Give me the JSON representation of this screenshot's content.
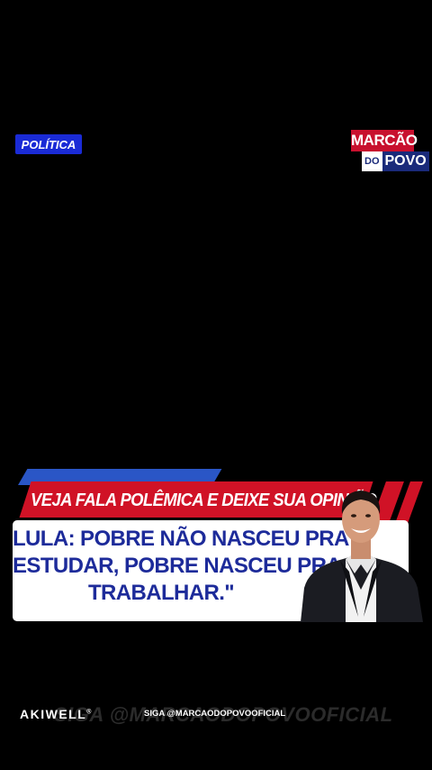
{
  "badge": {
    "label": "POLÍTICA",
    "color": "#1a2bd6"
  },
  "logo": {
    "top": "MARCÃO",
    "do": "DO",
    "povo": "POVO"
  },
  "banner": {
    "headline": "VEJA FALA POLÊMICA E DEIXE SUA OPINIÃO",
    "quote_lines": [
      "LULA: POBRE NÃO NASCEU PRA",
      "ESTUDAR, POBRE NASCEU PRA",
      "TRABALHAR.\""
    ]
  },
  "footer": {
    "brand": "AKIWELL",
    "brand_mark": "®",
    "siga": "SIGA @MARCAODOPOVOOFICIAL",
    "watermark": "SIGA @MARCAODOPOVOOFICIAL"
  },
  "colors": {
    "red": "#d01226",
    "blue": "#2a56c6",
    "navy_text": "#1d2b9a",
    "background": "#000000"
  }
}
